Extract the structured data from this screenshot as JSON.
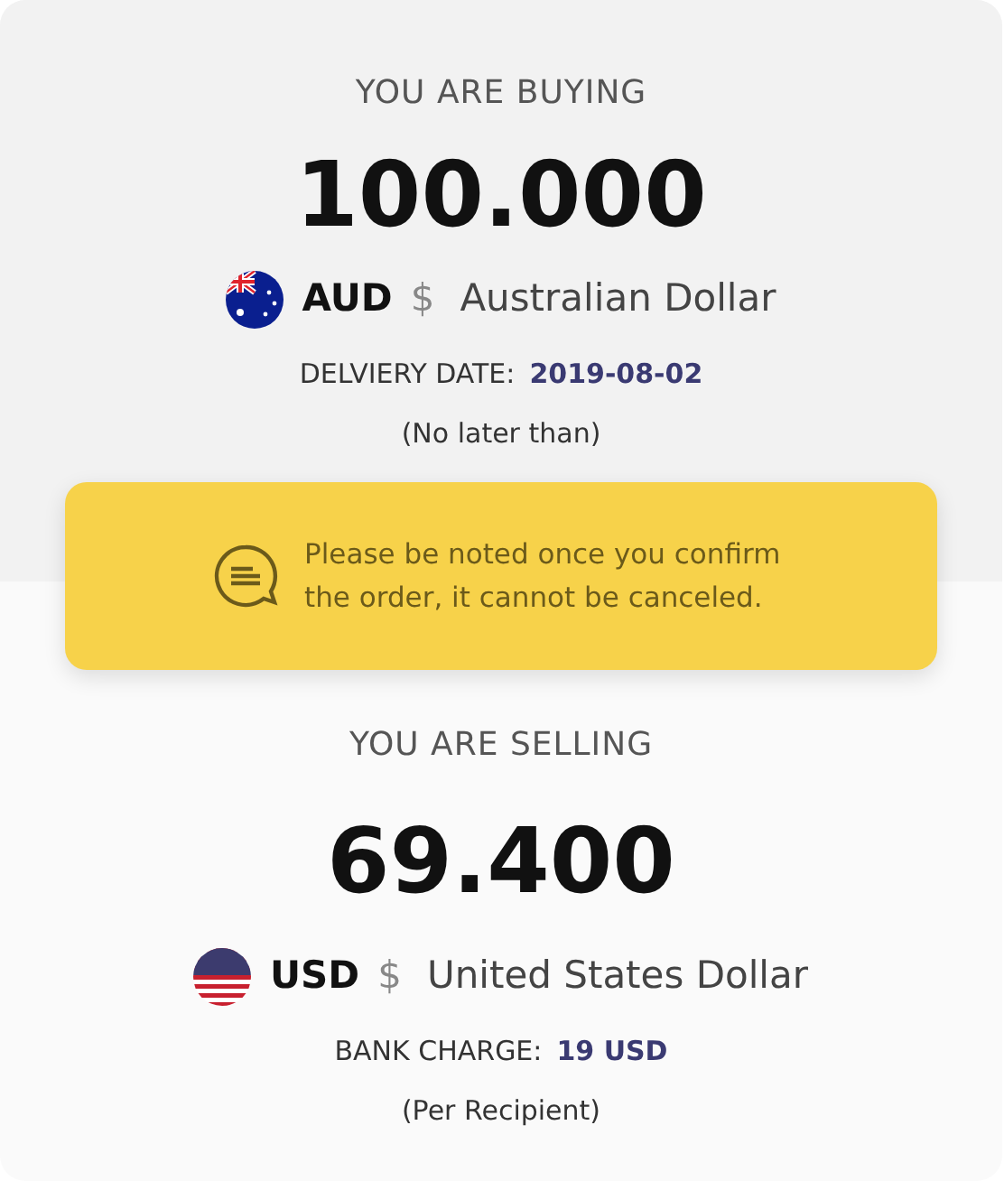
{
  "buying": {
    "title": "YOU ARE BUYING",
    "amount": "100.000",
    "currency": {
      "kind": "au",
      "code": "AUD",
      "symbol": "$",
      "name": "Australian Dollar"
    },
    "detail_label": "DELVIERY DATE:",
    "detail_value": "2019-08-02",
    "note": "(No later than)"
  },
  "notice": {
    "text": "Please be noted once you confirm the order, it cannot be canceled."
  },
  "selling": {
    "title": "YOU ARE SELLING",
    "amount": "69.400",
    "currency": {
      "kind": "us",
      "code": "USD",
      "symbol": "$",
      "name": "United States Dollar"
    },
    "detail_label": "BANK CHARGE:",
    "detail_value": "19 USD",
    "note": "(Per Recipient)"
  }
}
